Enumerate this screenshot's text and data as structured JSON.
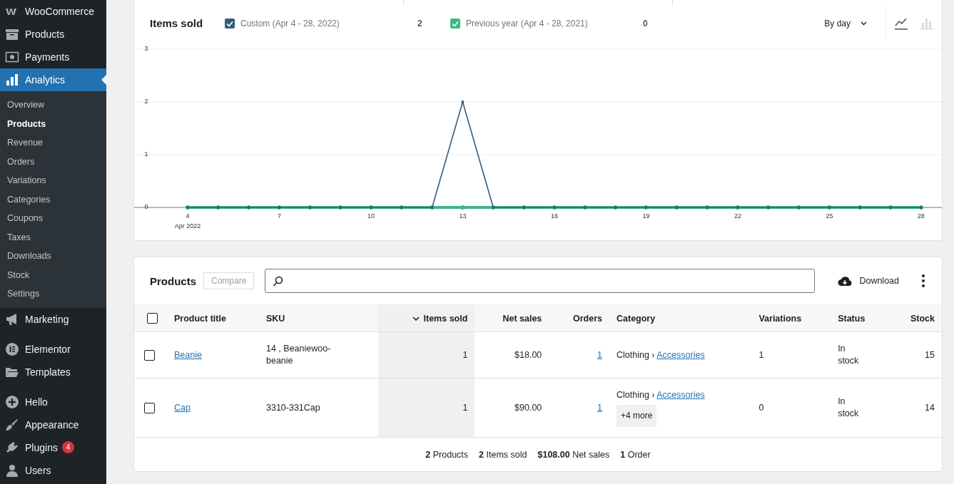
{
  "sidebar": {
    "items": [
      {
        "label": "WooCommerce",
        "selected": false
      },
      {
        "label": "Products",
        "selected": false
      },
      {
        "label": "Payments",
        "selected": false
      },
      {
        "label": "Analytics",
        "selected": true,
        "children": [
          {
            "label": "Overview",
            "selected": false
          },
          {
            "label": "Products",
            "selected": true
          },
          {
            "label": "Revenue",
            "selected": false
          },
          {
            "label": "Orders",
            "selected": false
          },
          {
            "label": "Variations",
            "selected": false
          },
          {
            "label": "Categories",
            "selected": false
          },
          {
            "label": "Coupons",
            "selected": false
          },
          {
            "label": "Taxes",
            "selected": false
          },
          {
            "label": "Downloads",
            "selected": false
          },
          {
            "label": "Stock",
            "selected": false
          },
          {
            "label": "Settings",
            "selected": false
          }
        ]
      },
      {
        "label": "Marketing",
        "selected": false
      },
      {
        "label": "Elementor",
        "selected": false,
        "separator_before": true
      },
      {
        "label": "Templates",
        "selected": false
      },
      {
        "label": "Hello",
        "selected": false,
        "separator_before": true
      },
      {
        "label": "Appearance",
        "selected": false
      },
      {
        "label": "Plugins",
        "selected": false,
        "badge": "4"
      },
      {
        "label": "Users",
        "selected": false
      }
    ]
  },
  "chart_card": {
    "title": "Items sold",
    "legend": [
      {
        "total": "2",
        "checked": true
      },
      {
        "total": "0",
        "checked": true
      }
    ],
    "interval": "By day",
    "view_buttons": [
      {
        "kind": "line",
        "selected": true
      },
      {
        "kind": "bar",
        "selected": false
      }
    ],
    "chart_data": {
      "type": "line",
      "x": [
        4,
        5,
        6,
        7,
        8,
        9,
        10,
        11,
        12,
        13,
        14,
        15,
        16,
        17,
        18,
        19,
        20,
        21,
        22,
        23,
        24,
        25,
        26,
        27,
        28
      ],
      "series": [
        {
          "name": "Custom (Apr 4 - 28, 2022)",
          "color": "#2f5f80",
          "marker": true,
          "values": [
            0,
            0,
            0,
            0,
            0,
            0,
            0,
            0,
            0,
            2,
            0,
            0,
            0,
            0,
            0,
            0,
            0,
            0,
            0,
            0,
            0,
            0,
            0,
            0,
            0
          ]
        },
        {
          "name": "Previous year (Apr 4 - 28, 2021)",
          "color": "#3cb884",
          "marker": true,
          "values": [
            0,
            0,
            0,
            0,
            0,
            0,
            0,
            0,
            0,
            0,
            0,
            0,
            0,
            0,
            0,
            0,
            0,
            0,
            0,
            0,
            0,
            0,
            0,
            0,
            0
          ]
        }
      ],
      "xlim": [
        2.25,
        28.68
      ],
      "ylim": [
        0,
        3
      ],
      "xticks": [
        4,
        7,
        10,
        13,
        16,
        19,
        22,
        25,
        28
      ],
      "yticks": [
        0,
        1,
        2,
        3
      ],
      "annotations": [
        "Apr 2022"
      ]
    }
  },
  "products_card": {
    "title": "Products",
    "compare": "Compare",
    "download": "Download",
    "table": {
      "select_all": {
        "checked": false
      },
      "columns": [
        {
          "label": "Product title",
          "sorted": false
        },
        {
          "label": "SKU",
          "sorted": false
        },
        {
          "label": "Items sold",
          "sorted": true
        },
        {
          "label": "Net sales",
          "sorted": false
        },
        {
          "label": "Orders",
          "sorted": false
        },
        {
          "label": "Category",
          "sorted": false
        },
        {
          "label": "Variations",
          "sorted": false
        },
        {
          "label": "Status",
          "sorted": false
        },
        {
          "label": "Stock",
          "sorted": false
        }
      ],
      "rows": [
        {
          "checked": false,
          "cells": [
            {
              "kind": "link",
              "text": "Beanie"
            },
            {
              "kind": "text",
              "text": "14 , Beaniewoo-beanie"
            },
            {
              "kind": "text",
              "text": "1"
            },
            {
              "kind": "text",
              "text": "$18.00"
            },
            {
              "kind": "link",
              "text": "1"
            },
            {
              "kind": "category",
              "text": "Clothing ›",
              "link": "Accessories"
            },
            {
              "kind": "text",
              "text": "1"
            },
            {
              "kind": "status",
              "text": "In stock"
            },
            {
              "kind": "text",
              "text": "15"
            }
          ]
        },
        {
          "checked": false,
          "cells": [
            {
              "kind": "link",
              "text": "Cap"
            },
            {
              "kind": "text",
              "text": "3310-331Cap"
            },
            {
              "kind": "text",
              "text": "1"
            },
            {
              "kind": "text",
              "text": "$90.00"
            },
            {
              "kind": "link",
              "text": "1"
            },
            {
              "kind": "category",
              "text": "Clothing ›",
              "link": "Accessories",
              "more": "+4 more"
            },
            {
              "kind": "text",
              "text": "0"
            },
            {
              "kind": "status",
              "text": "In stock"
            },
            {
              "kind": "text",
              "text": "14"
            }
          ]
        }
      ],
      "summary": [
        "**2** Products",
        "**2** Items sold",
        "**$108.00** Net sales",
        "**1** Order"
      ]
    }
  }
}
